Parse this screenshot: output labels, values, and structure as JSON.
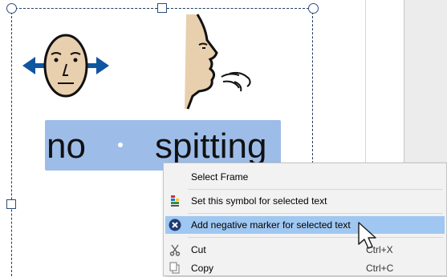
{
  "document": {
    "symbols": [
      {
        "icon": "face-sideways-arrows-icon"
      },
      {
        "icon": "spitting-profile-icon"
      }
    ],
    "words": [
      "no",
      "spitting"
    ]
  },
  "context_menu": {
    "items": [
      {
        "id": "select_frame",
        "label": "Select Frame",
        "icon": "",
        "shortcut": ""
      },
      {
        "id": "set_symbol",
        "label": "Set this symbol for selected text",
        "icon": "symbol-palette-icon",
        "shortcut": ""
      },
      {
        "id": "add_negative",
        "label": "Add negative marker for selected text",
        "icon": "negative-marker-icon",
        "shortcut": "",
        "highlighted": true
      },
      {
        "id": "cut",
        "label": "Cut",
        "icon": "scissors-icon",
        "shortcut": "Ctrl+X"
      },
      {
        "id": "copy",
        "label": "Copy",
        "icon": "copy-icon",
        "shortcut": "Ctrl+C"
      }
    ]
  },
  "colors": {
    "selection": "#9dbde8",
    "menu_highlight": "#9fc7f1",
    "arrow_blue": "#0f55a0",
    "skin": "#e8cfae",
    "frame_border": "#1f3b60"
  }
}
